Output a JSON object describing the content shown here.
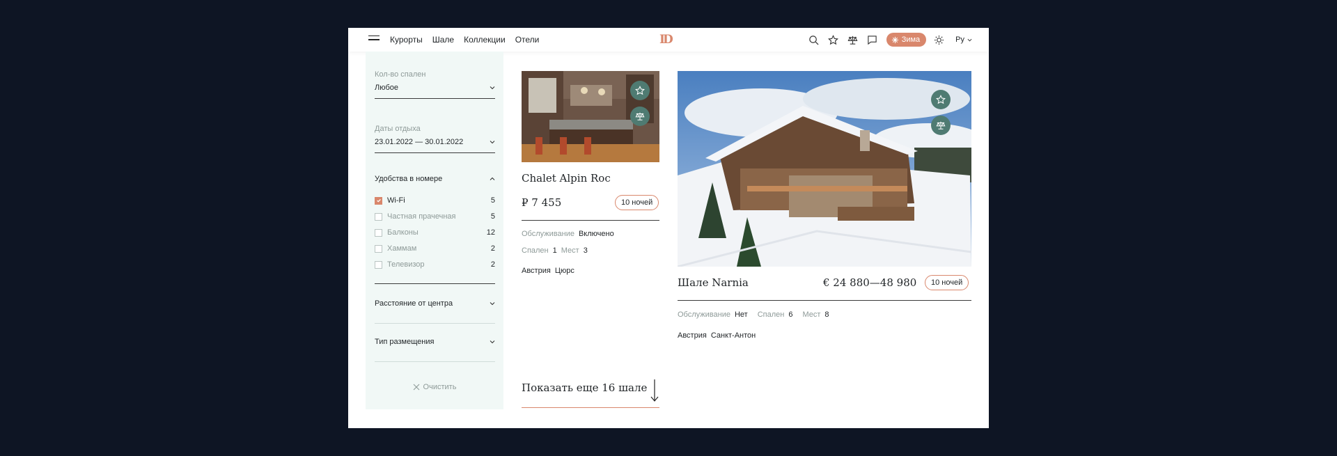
{
  "nav": {
    "items": [
      "Курорты",
      "Шале",
      "Коллекции",
      "Отели"
    ],
    "logo": "ID"
  },
  "toolbar": {
    "season_label": "Зима",
    "lang_label": "Ру"
  },
  "filters": {
    "bedrooms": {
      "label": "Кол-во спален",
      "value": "Любое"
    },
    "dates": {
      "label": "Даты отдыха",
      "value": "23.01.2022 — 30.01.2022"
    },
    "amenities": {
      "title": "Удобства в номере",
      "options": [
        {
          "label": "Wi-Fi",
          "count": "5",
          "checked": true
        },
        {
          "label": "Частная прачечная",
          "count": "5",
          "checked": false
        },
        {
          "label": "Балконы",
          "count": "12",
          "checked": false
        },
        {
          "label": "Хаммам",
          "count": "2",
          "checked": false
        },
        {
          "label": "Телевизор",
          "count": "2",
          "checked": false
        }
      ]
    },
    "distance": {
      "title": "Расстояние от центра"
    },
    "type": {
      "title": "Тип размещения"
    },
    "clear_label": "Очистить"
  },
  "cards": [
    {
      "title": "Chalet Alpin Roc",
      "price": "₽ 7 455",
      "nights": "10 ночей",
      "service_label": "Обслуживание",
      "service_value": "Включено",
      "bedrooms_label": "Спален",
      "bedrooms_value": "1",
      "places_label": "Мест",
      "places_value": "3",
      "country": "Австрия",
      "resort": "Цюрс"
    },
    {
      "title": "Шале Narnia",
      "price": "€ 24 880—48 980",
      "nights": "10 ночей",
      "service_label": "Обслуживание",
      "service_value": "Нет",
      "bedrooms_label": "Спален",
      "bedrooms_value": "6",
      "places_label": "Мест",
      "places_value": "8",
      "country": "Австрия",
      "resort": "Санкт-Антон"
    }
  ],
  "show_more_label": "Показать еще 16 шале",
  "colors": {
    "accent": "#d9876c",
    "teal": "#4f7b72",
    "sidebar_bg": "#f1f8f6",
    "page_bg": "#0e1524"
  }
}
